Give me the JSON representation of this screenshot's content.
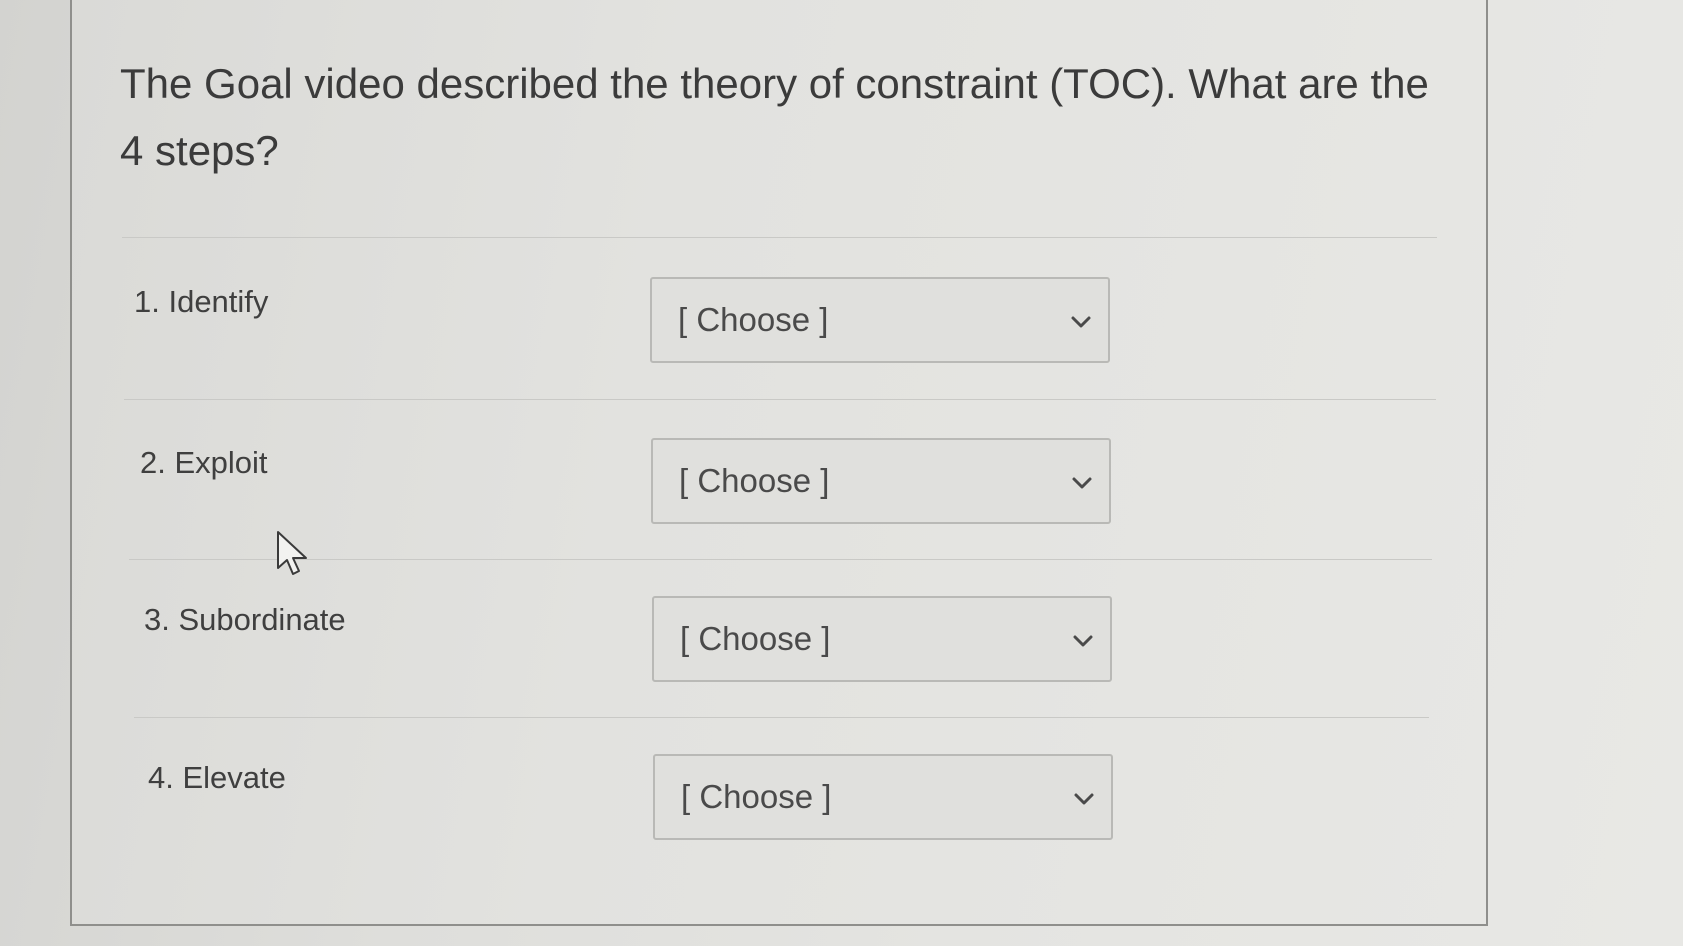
{
  "question": {
    "text": "The Goal video described the theory of constraint (TOC).  What are the 4 steps?"
  },
  "answers": [
    {
      "label": "1. Identify",
      "selected": "[ Choose ]"
    },
    {
      "label": "2. Exploit",
      "selected": "[ Choose ]"
    },
    {
      "label": "3. Subordinate",
      "selected": "[ Choose ]"
    },
    {
      "label": "4. Elevate",
      "selected": "[ Choose ]"
    }
  ],
  "icons": {
    "dropdown": "chevron-down-icon",
    "pointer": "mouse-cursor-icon"
  },
  "colors": {
    "text": "#3b3b3b",
    "border": "#8f8f8c"
  }
}
